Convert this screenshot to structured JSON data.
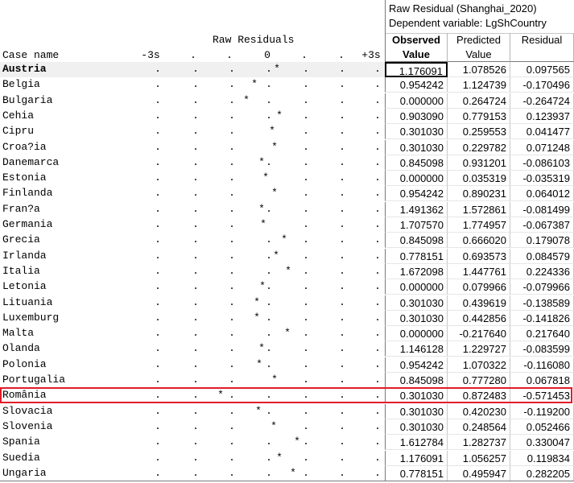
{
  "header": {
    "title_line1": "Raw Residual (Shanghai_2020)",
    "title_line2": "Dependent variable: LgShCountry",
    "plot_title": "Raw Residuals",
    "case_name_label": "Case name",
    "axis_labels": [
      "-3s",
      ".",
      ".",
      "0",
      ".",
      ".",
      "+3s"
    ],
    "columns": [
      {
        "line1": "Observed",
        "line2": "Value"
      },
      {
        "line1": "Predicted",
        "line2": "Value"
      },
      {
        "line1": "Residual",
        "line2": ""
      }
    ]
  },
  "rows": [
    {
      "name": "Austria",
      "observed": "1.176091",
      "predicted": "1.078526",
      "residual": "0.097565"
    },
    {
      "name": "Belgia",
      "observed": "0.954242",
      "predicted": "1.124739",
      "residual": "-0.170496"
    },
    {
      "name": "Bulgaria",
      "observed": "0.000000",
      "predicted": "0.264724",
      "residual": "-0.264724"
    },
    {
      "name": "Cehia",
      "observed": "0.903090",
      "predicted": "0.779153",
      "residual": "0.123937"
    },
    {
      "name": "Cipru",
      "observed": "0.301030",
      "predicted": "0.259553",
      "residual": "0.041477"
    },
    {
      "name": "Croa?ia",
      "observed": "0.301030",
      "predicted": "0.229782",
      "residual": "0.071248"
    },
    {
      "name": "Danemarca",
      "observed": "0.845098",
      "predicted": "0.931201",
      "residual": "-0.086103"
    },
    {
      "name": "Estonia",
      "observed": "0.000000",
      "predicted": "0.035319",
      "residual": "-0.035319"
    },
    {
      "name": "Finlanda",
      "observed": "0.954242",
      "predicted": "0.890231",
      "residual": "0.064012"
    },
    {
      "name": "Fran?a",
      "observed": "1.491362",
      "predicted": "1.572861",
      "residual": "-0.081499"
    },
    {
      "name": "Germania",
      "observed": "1.707570",
      "predicted": "1.774957",
      "residual": "-0.067387"
    },
    {
      "name": "Grecia",
      "observed": "0.845098",
      "predicted": "0.666020",
      "residual": "0.179078"
    },
    {
      "name": "Irlanda",
      "observed": "0.778151",
      "predicted": "0.693573",
      "residual": "0.084579"
    },
    {
      "name": "Italia",
      "observed": "1.672098",
      "predicted": "1.447761",
      "residual": "0.224336"
    },
    {
      "name": "Letonia",
      "observed": "0.000000",
      "predicted": "0.079966",
      "residual": "-0.079966"
    },
    {
      "name": "Lituania",
      "observed": "0.301030",
      "predicted": "0.439619",
      "residual": "-0.138589"
    },
    {
      "name": "Luxemburg",
      "observed": "0.301030",
      "predicted": "0.442856",
      "residual": "-0.141826"
    },
    {
      "name": "Malta",
      "observed": "0.000000",
      "predicted": "-0.217640",
      "residual": "0.217640"
    },
    {
      "name": "Olanda",
      "observed": "1.146128",
      "predicted": "1.229727",
      "residual": "-0.083599"
    },
    {
      "name": "Polonia",
      "observed": "0.954242",
      "predicted": "1.070322",
      "residual": "-0.116080"
    },
    {
      "name": "Portugalia",
      "observed": "0.845098",
      "predicted": "0.777280",
      "residual": "0.067818"
    },
    {
      "name": "România",
      "observed": "0.301030",
      "predicted": "0.872483",
      "residual": "-0.571453"
    },
    {
      "name": "Slovacia",
      "observed": "0.301030",
      "predicted": "0.420230",
      "residual": "-0.119200"
    },
    {
      "name": "Slovenia",
      "observed": "0.301030",
      "predicted": "0.248564",
      "residual": "0.052466"
    },
    {
      "name": "Spania",
      "observed": "1.612784",
      "predicted": "1.282737",
      "residual": "0.330047"
    },
    {
      "name": "Suedia",
      "observed": "1.176091",
      "predicted": "1.056257",
      "residual": "0.119834"
    },
    {
      "name": "Ungaria",
      "observed": "0.778151",
      "predicted": "0.495947",
      "residual": "0.282205"
    }
  ],
  "highlighted_row": "România",
  "selected_cell": {
    "row": 0,
    "column": "observed"
  },
  "colors": {
    "highlight_border": "#e11d2a",
    "grid_line": "#c8c8c8",
    "header_border": "#7a7a7a"
  },
  "plot": {
    "marker": "*",
    "tick": ".",
    "scale_min": -0.6,
    "scale_max": 0.6
  }
}
